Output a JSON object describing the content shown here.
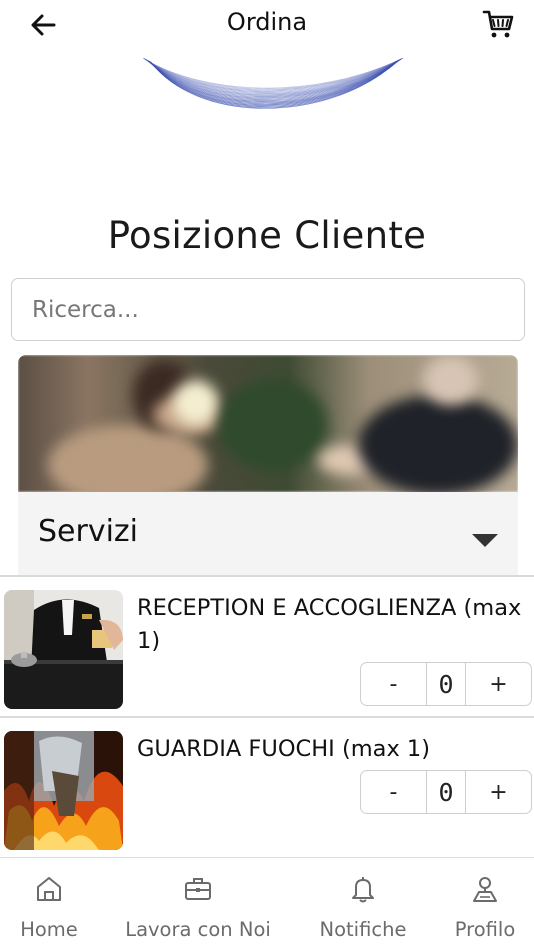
{
  "header": {
    "title": "Ordina",
    "back_icon": "arrow-left-icon",
    "cart_icon": "shopping-cart-icon"
  },
  "page": {
    "title": "Posizione Cliente"
  },
  "search": {
    "placeholder": "Ricerca...",
    "value": ""
  },
  "category": {
    "label": "Servizi",
    "expand_icon": "caret-down-icon"
  },
  "services": [
    {
      "name": "RECEPTION E ACCOGLIENZA (max 1)",
      "quantity": "0",
      "minus_label": "-",
      "plus_label": "+"
    },
    {
      "name": "GUARDIA FUOCHI (max 1)",
      "quantity": "0",
      "minus_label": "-",
      "plus_label": "+"
    }
  ],
  "bottom_nav": [
    {
      "label": "Home",
      "icon": "home-icon"
    },
    {
      "label": "Lavora con Noi",
      "icon": "briefcase-icon"
    },
    {
      "label": "Notifiche",
      "icon": "bell-icon"
    },
    {
      "label": "Profilo",
      "icon": "user-pin-icon"
    }
  ],
  "colors": {
    "accent_wave": "#3b4fb0",
    "text": "#111111",
    "muted": "#6b6b6b",
    "border": "#cfcfcf"
  }
}
